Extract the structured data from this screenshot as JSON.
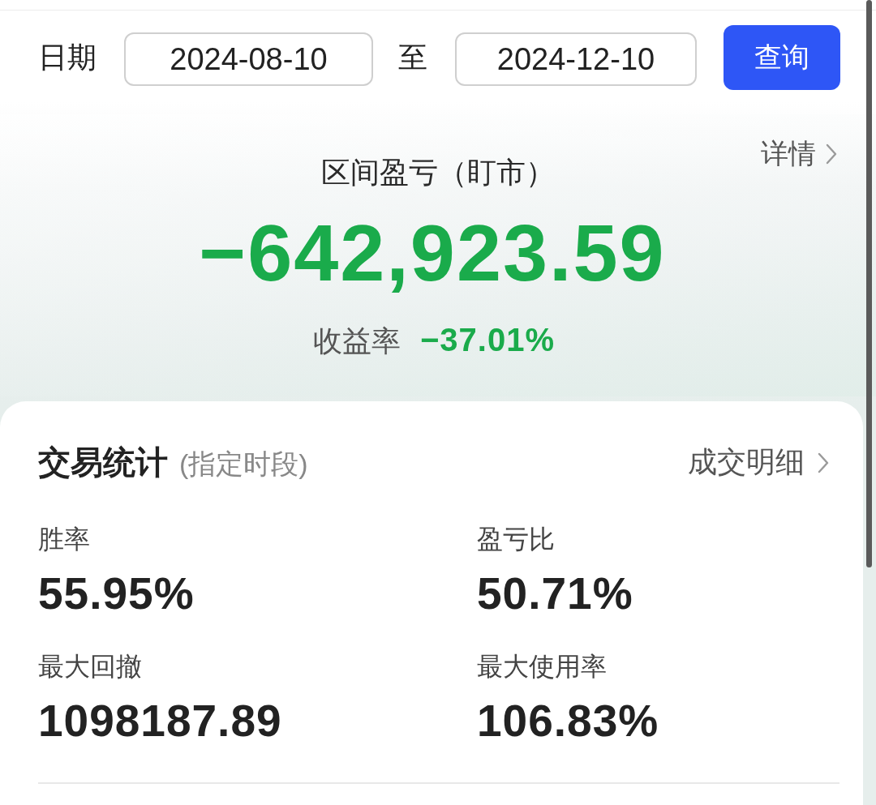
{
  "date_filter": {
    "label": "日期",
    "start_date": "2024-08-10",
    "separator": "至",
    "end_date": "2024-12-10",
    "button": "查询"
  },
  "summary": {
    "title": "区间盈亏（盯市）",
    "detail_link": "详情",
    "pnl": "−642,923.59",
    "return_label": "收益率",
    "return_value": "−37.01%"
  },
  "stats": {
    "title": "交易统计",
    "subtitle": "(指定时段)",
    "link": "成交明细",
    "items": [
      {
        "label": "胜率",
        "value": "55.95%"
      },
      {
        "label": "盈亏比",
        "value": "50.71%"
      },
      {
        "label": "最大回撤",
        "value": "1098187.89"
      },
      {
        "label": "最大使用率",
        "value": "106.83%"
      }
    ]
  }
}
